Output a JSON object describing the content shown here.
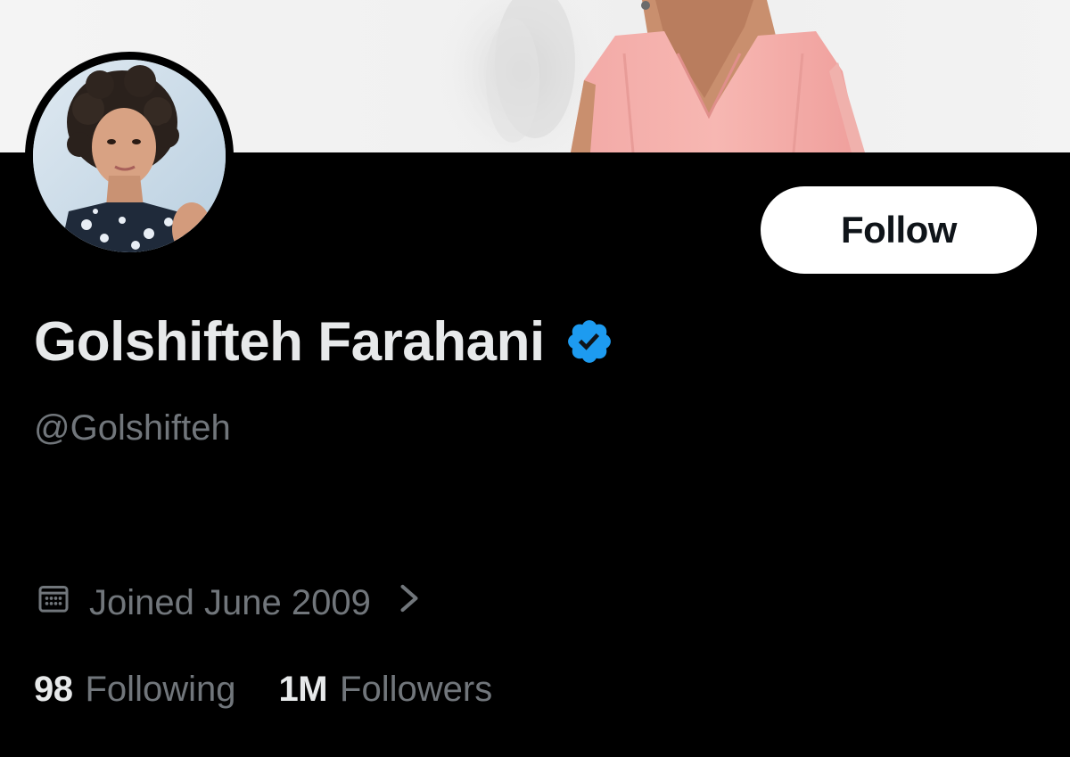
{
  "profile": {
    "display_name": "Golshifteh Farahani",
    "handle": "@Golshifteh",
    "verified": true,
    "joined": "Joined June 2009"
  },
  "actions": {
    "follow_label": "Follow"
  },
  "stats": {
    "following_count": "98",
    "following_label": "Following",
    "followers_count": "1M",
    "followers_label": "Followers"
  },
  "icons": {
    "verified": "verified-badge-icon",
    "calendar": "calendar-icon",
    "chevron": "chevron-right-icon"
  },
  "colors": {
    "background": "#000000",
    "primary_text": "#e7e9ea",
    "secondary_text": "#71767b",
    "verified_blue": "#1d9bf0",
    "button_bg": "#ffffff",
    "button_text": "#0f1419"
  }
}
